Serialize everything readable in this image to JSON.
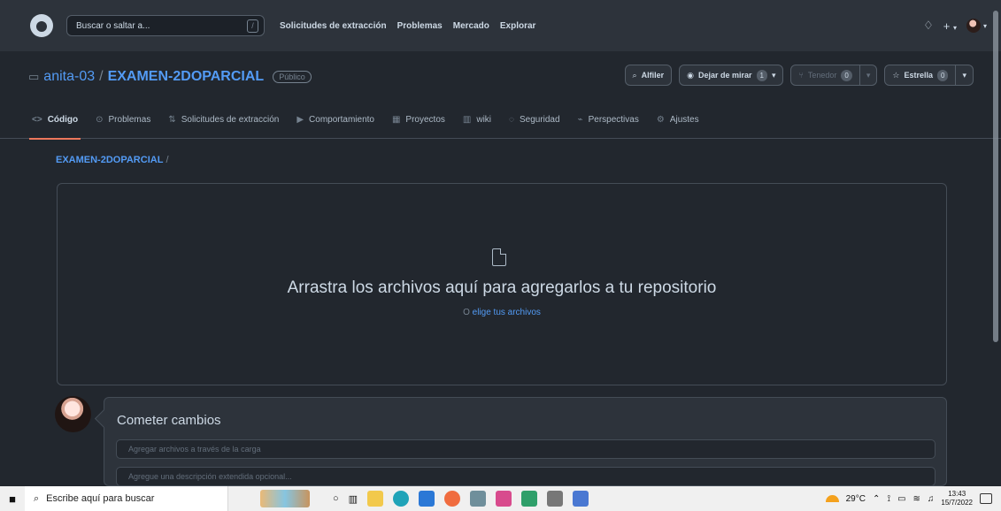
{
  "github": {
    "search_placeholder": "Buscar o saltar a...",
    "shortcut_key": "/",
    "nav": [
      "Solicitudes de extracción",
      "Problemas",
      "Mercado",
      "Explorar"
    ],
    "icons": {
      "logo": "github-mark",
      "notifications": "bell-icon",
      "create": "plus-icon",
      "avatar": "user-avatar"
    }
  },
  "repo": {
    "owner": "anita-03",
    "separator": "/",
    "name": "EXAMEN-2DOPARCIAL",
    "visibility": "Público",
    "pin_label": "Alfiler",
    "watch_label": "Dejar de mirar",
    "watch_count": "1",
    "fork_label": "Tenedor",
    "fork_count": "0",
    "star_label": "Estrella",
    "star_count": "0"
  },
  "tabs": [
    {
      "label": "Código",
      "icon": "<>",
      "active": true
    },
    {
      "label": "Problemas",
      "icon": "⊙"
    },
    {
      "label": "Solicitudes de extracción",
      "icon": "⇅"
    },
    {
      "label": "Comportamiento",
      "icon": "▶"
    },
    {
      "label": "Proyectos",
      "icon": "▦"
    },
    {
      "label": "wiki",
      "icon": "▥"
    },
    {
      "label": "Seguridad",
      "icon": "◌"
    },
    {
      "label": "Perspectivas",
      "icon": "⌁"
    },
    {
      "label": "Ajustes",
      "icon": "⚙"
    }
  ],
  "upload": {
    "breadcrumb_repo": "EXAMEN-2DOPARCIAL",
    "breadcrumb_slash": "/",
    "drop_title": "Arrastra los archivos aquí para agregarlos a tu repositorio",
    "drop_prefix": "O",
    "choose_files": "elige tus archivos"
  },
  "commit": {
    "title": "Cometer cambios",
    "summary_placeholder": "Agregar archivos a través de la carga",
    "description_placeholder": "Agregue una descripción extendida opcional..."
  },
  "taskbar": {
    "search_text": "Escribe aquí para buscar",
    "temperature": "29°C",
    "time": "13:43",
    "date": "15/7/2022"
  },
  "colors": {
    "background": "#22272e",
    "header": "#2d333b",
    "link": "#539bf5",
    "active_tab": "#ec775c"
  }
}
